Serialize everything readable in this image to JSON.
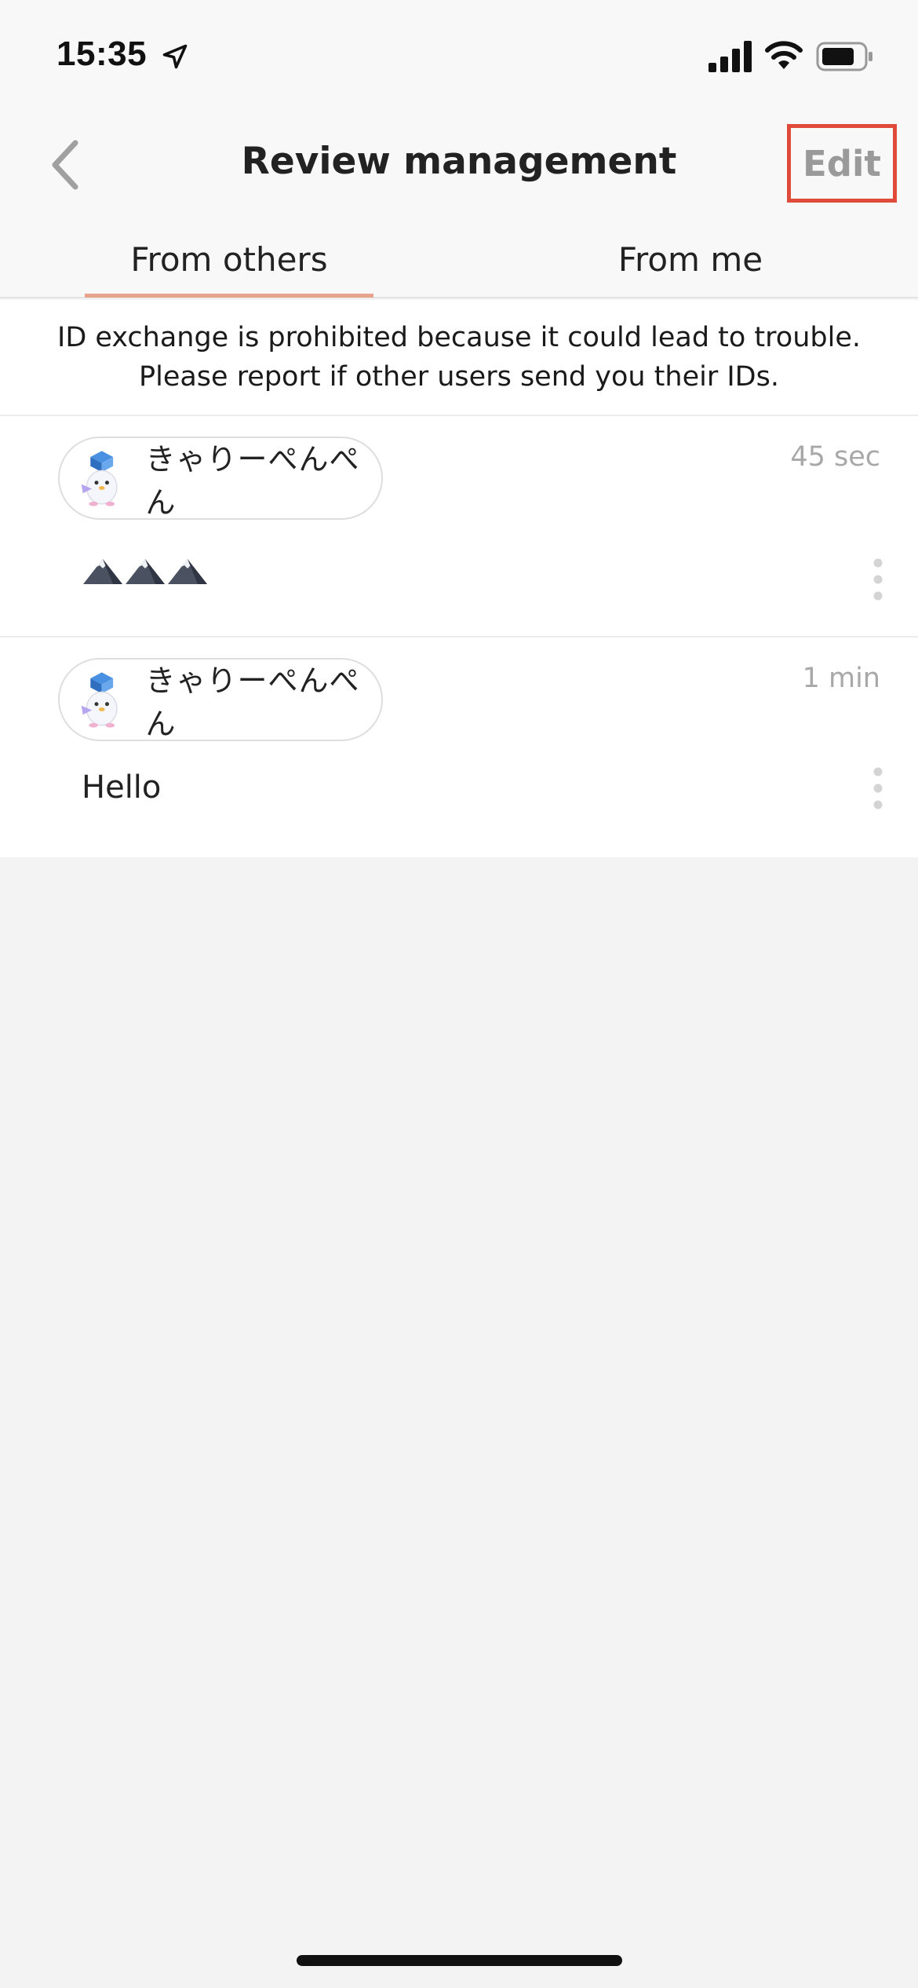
{
  "status_bar": {
    "time": "15:35",
    "icons": [
      "location-arrow-icon",
      "signal-icon",
      "wifi-icon",
      "battery-icon"
    ]
  },
  "nav": {
    "title": "Review management",
    "edit_label": "Edit",
    "back_icon": "chevron-left-icon"
  },
  "tabs": [
    {
      "label": "From others",
      "selected": true
    },
    {
      "label": "From me",
      "selected": false
    }
  ],
  "notice": {
    "line1": "ID exchange is prohibited because it could lead to trouble.",
    "line2": "Please report if other users send you their IDs."
  },
  "reviews": [
    {
      "user_name": "きゃりーぺんぺん",
      "time": "45 sec",
      "message_icons": [
        "mountain-icon",
        "mountain-icon",
        "mountain-icon"
      ]
    },
    {
      "user_name": "きゃりーぺんぺん",
      "time": "1 min",
      "message": "Hello"
    }
  ],
  "colors": {
    "accent_underline": "#e8a38c",
    "highlight_box": "#e04a3a",
    "muted_text": "#a8a8a8"
  }
}
